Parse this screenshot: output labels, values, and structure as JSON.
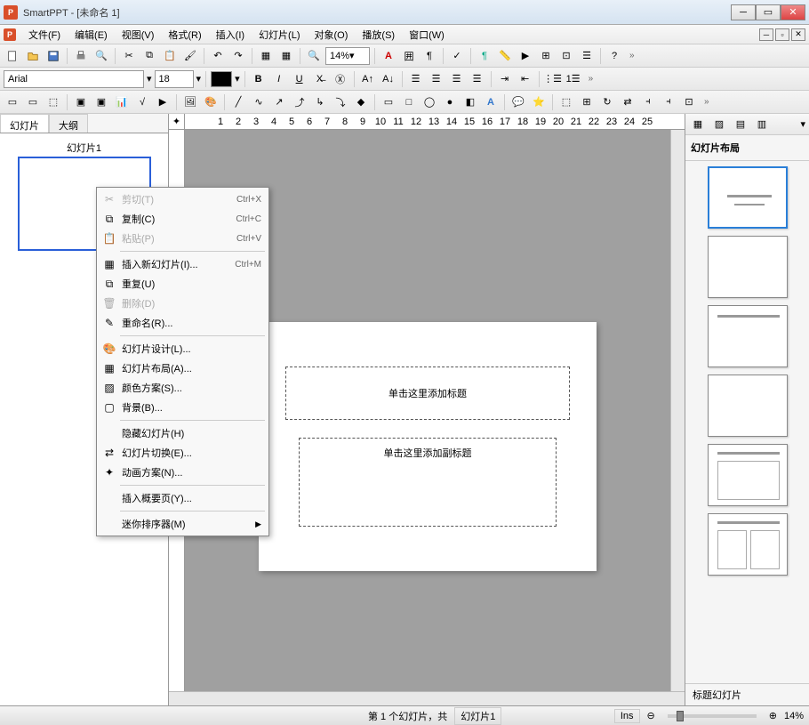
{
  "title": "SmartPPT - [未命名 1]",
  "menubar": [
    "文件(F)",
    "编辑(E)",
    "视图(V)",
    "格式(R)",
    "插入(I)",
    "幻灯片(L)",
    "对象(O)",
    "播放(S)",
    "窗口(W)"
  ],
  "zoom_value": "14%",
  "font_name": "Arial",
  "font_size": "18",
  "panel_tabs": {
    "slides": "幻灯片",
    "outline": "大纲"
  },
  "thumb_label": "幻灯片1",
  "placeholder_title": "单击这里添加标题",
  "placeholder_subtitle": "单击这里添加副标题",
  "right_panel_title": "幻灯片布局",
  "right_panel_footer": "标题幻灯片",
  "ruler_numbers": [
    "1",
    "2",
    "3",
    "4",
    "5",
    "6",
    "7",
    "8",
    "9",
    "10",
    "11",
    "12",
    "13",
    "14",
    "15",
    "16",
    "17",
    "18",
    "19",
    "20",
    "21",
    "22",
    "23",
    "24",
    "25"
  ],
  "context_menu": {
    "cut": {
      "label": "剪切(T)",
      "shortcut": "Ctrl+X"
    },
    "copy": {
      "label": "复制(C)",
      "shortcut": "Ctrl+C"
    },
    "paste": {
      "label": "粘贴(P)",
      "shortcut": "Ctrl+V"
    },
    "insert": {
      "label": "插入新幻灯片(I)...",
      "shortcut": "Ctrl+M"
    },
    "duplicate": {
      "label": "重复(U)"
    },
    "delete": {
      "label": "删除(D)"
    },
    "rename": {
      "label": "重命名(R)..."
    },
    "design": {
      "label": "幻灯片设计(L)..."
    },
    "layout": {
      "label": "幻灯片布局(A)..."
    },
    "color": {
      "label": "颜色方案(S)..."
    },
    "background": {
      "label": "背景(B)..."
    },
    "hide": {
      "label": "隐藏幻灯片(H)"
    },
    "transition": {
      "label": "幻灯片切换(E)..."
    },
    "animation": {
      "label": "动画方案(N)..."
    },
    "insert_summary": {
      "label": "插入概要页(Y)..."
    },
    "mini_sorter": {
      "label": "迷你排序器(M)"
    }
  },
  "status": {
    "slide_info": "第 1 个幻灯片，共",
    "slide_name": "幻灯片1",
    "ins": "Ins",
    "zoom": "14%"
  }
}
